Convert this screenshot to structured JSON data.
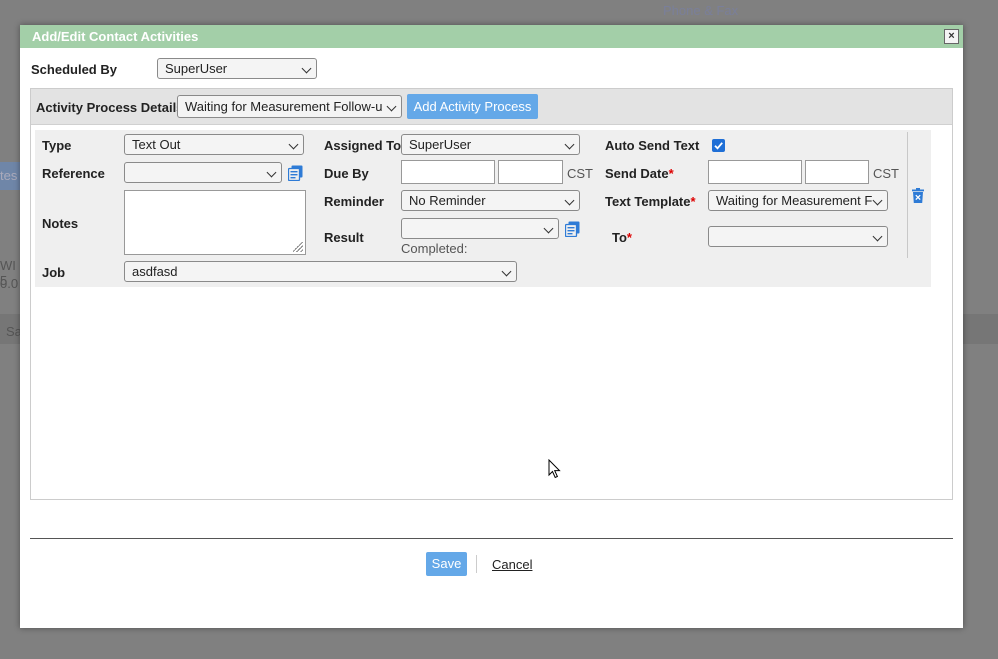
{
  "background": {
    "phone_fax": "Phone & Fax",
    "frag_tes": "tes",
    "frag_wi": "WI 5",
    "frag_zero": "0.0",
    "frag_sa": "Sa"
  },
  "dialog": {
    "title": "Add/Edit Contact Activities",
    "close_glyph": "×"
  },
  "scheduled_by": {
    "label": "Scheduled By",
    "value": "SuperUser"
  },
  "activity_process": {
    "label": "Activity Process Details",
    "value": "Waiting for Measurement Follow-u",
    "add_button": "Add Activity Process"
  },
  "activity": {
    "type_label": "Type",
    "type_value": "Text Out",
    "reference_label": "Reference",
    "reference_value": "",
    "notes_label": "Notes",
    "job_label": "Job",
    "job_value": "asdfasd",
    "assigned_to_label": "Assigned To",
    "assigned_to_value": "SuperUser",
    "due_by_label": "Due By",
    "due_by_tz": "CST",
    "reminder_label": "Reminder",
    "reminder_value": "No Reminder",
    "result_label": "Result",
    "result_value": "",
    "completed_label": "Completed:",
    "auto_send_label": "Auto Send Text",
    "send_date_label": "Send Date",
    "send_date_tz": "CST",
    "text_template_label": "Text Template",
    "text_template_value": "Waiting for Measurement F",
    "to_label": "To",
    "to_value": "",
    "required_mark": "*"
  },
  "footer": {
    "save": "Save",
    "cancel": "Cancel"
  },
  "colors": {
    "titlebar": "#a3cfa8",
    "accent_blue": "#64a8e8",
    "checkbox_blue": "#1f6fd6",
    "required_red": "#dd0000"
  }
}
